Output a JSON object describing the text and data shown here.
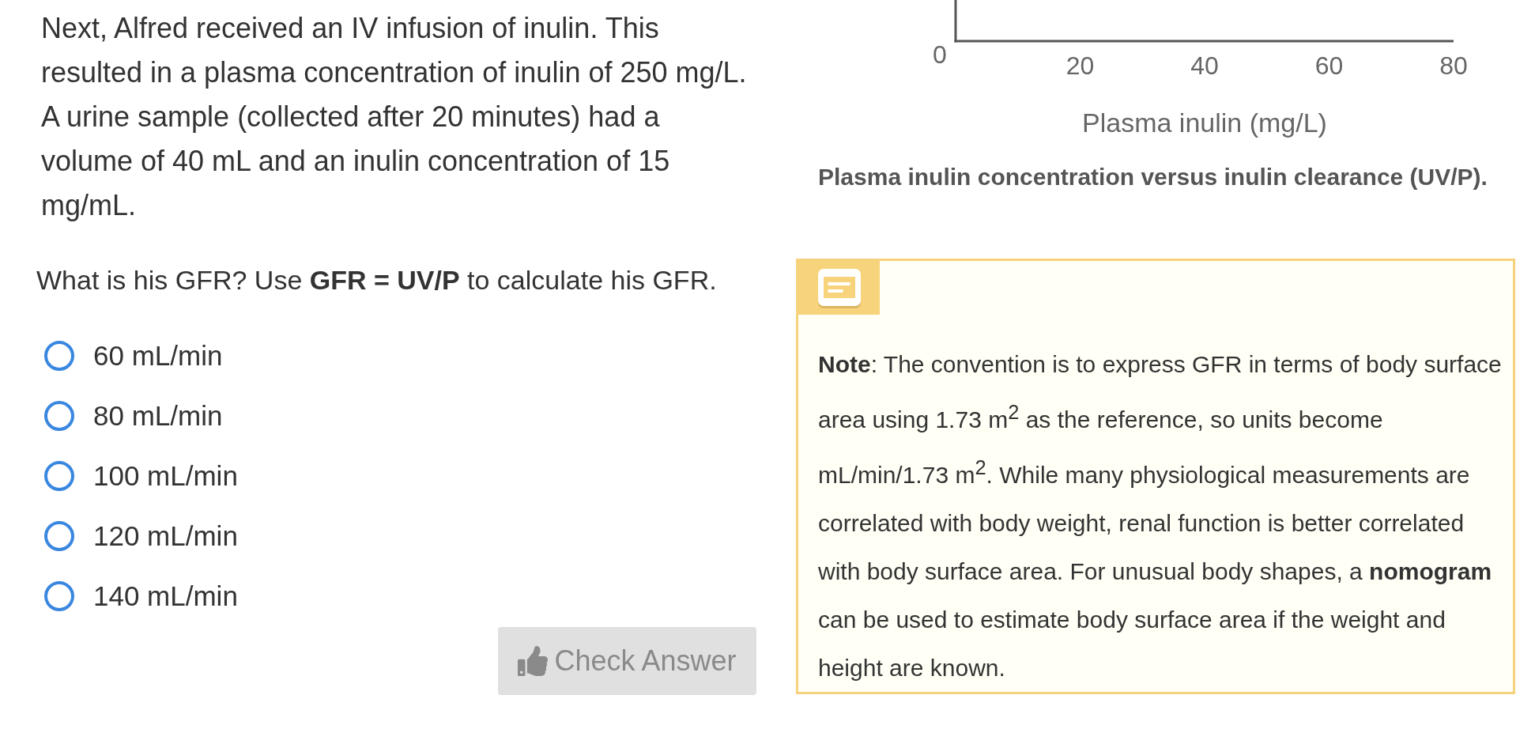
{
  "problem": {
    "paragraph": "Next, Alfred received an IV infusion of inulin. This resulted in a plasma concentration of inulin of 250 mg/L. A urine sample (collected after 20 minutes) had a volume of 40 mL and an inulin concentration of 15 mg/mL.",
    "question": "What is his GFR? Use **GFR = UV/P** to calculate his GFR.",
    "options": [
      {
        "label": "60 mL/min",
        "selected": false
      },
      {
        "label": "80 mL/min",
        "selected": false
      },
      {
        "label": "100 mL/min",
        "selected": false
      },
      {
        "label": "120 mL/min",
        "selected": false
      },
      {
        "label": "140 mL/min",
        "selected": false
      }
    ],
    "check_button": {
      "label": "Check Answer",
      "disabled": true
    }
  },
  "figure": {
    "axis_origin_label": "0",
    "x_tick_labels": [
      "20",
      "40",
      "60",
      "80"
    ],
    "x_axis_title": "Plasma inulin (mg/L)",
    "caption": "Plasma inulin concentration versus inulin clearance (UV/P)."
  },
  "note": {
    "text": "**Note**: The convention is to express GFR in terms of body surface area using 1.73 m$^{2}$ as the reference, so units become mL/min/1.73 m$^{2}$. While many physiological measurements are correlated with body weight, renal function is better correlated with body surface area. For unusual body shapes, a **nomogram** can be used to estimate body surface area if the weight and height are known."
  }
}
